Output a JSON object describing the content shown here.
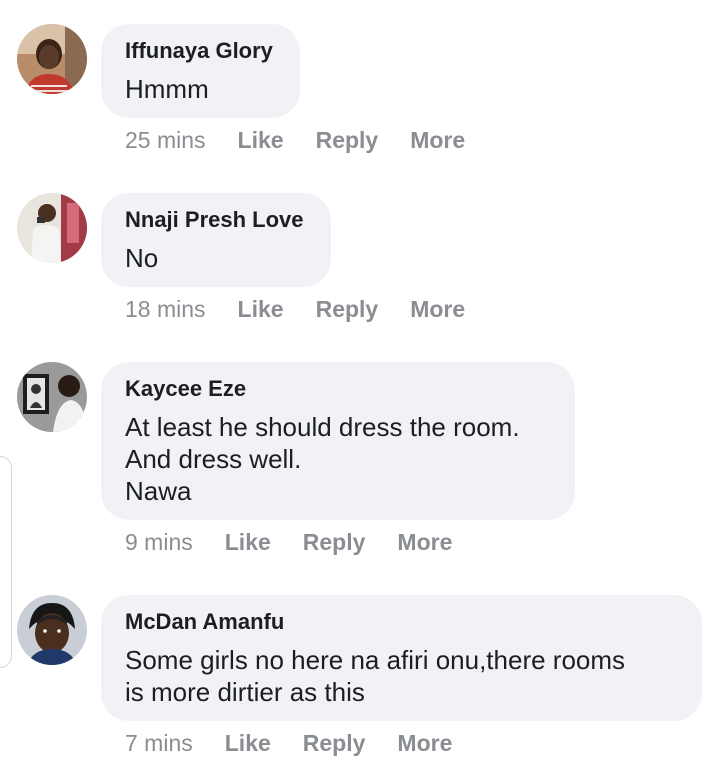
{
  "comments": [
    {
      "author": "Iffunaya Glory",
      "text": [
        "Hmmm"
      ],
      "time": "25 mins",
      "actions": {
        "like": "Like",
        "reply": "Reply",
        "more": "More"
      },
      "avatar": "profile-photo-woman-red-top"
    },
    {
      "author": "Nnaji Presh Love",
      "text": [
        "No"
      ],
      "time": "18 mins",
      "actions": {
        "like": "Like",
        "reply": "Reply",
        "more": "More"
      },
      "avatar": "profile-photo-person-white-outfit"
    },
    {
      "author": "Kaycee Eze",
      "text": [
        "At least he should dress the room.",
        "And dress well.",
        "Nawa"
      ],
      "time": "9 mins",
      "actions": {
        "like": "Like",
        "reply": "Reply",
        "more": "More"
      },
      "avatar": "profile-photo-man-with-portrait"
    },
    {
      "author": "McDan Amanfu",
      "text": [
        "Some girls no here na afiri onu,there rooms",
        "is more dirtier as this"
      ],
      "time": "7 mins",
      "actions": {
        "like": "Like",
        "reply": "Reply",
        "more": "More"
      },
      "avatar": "profile-photo-man-headwrap"
    }
  ],
  "colors": {
    "bubble": "#f0f2f5",
    "text": "#1c1e21",
    "meta": "#8a8d91"
  }
}
